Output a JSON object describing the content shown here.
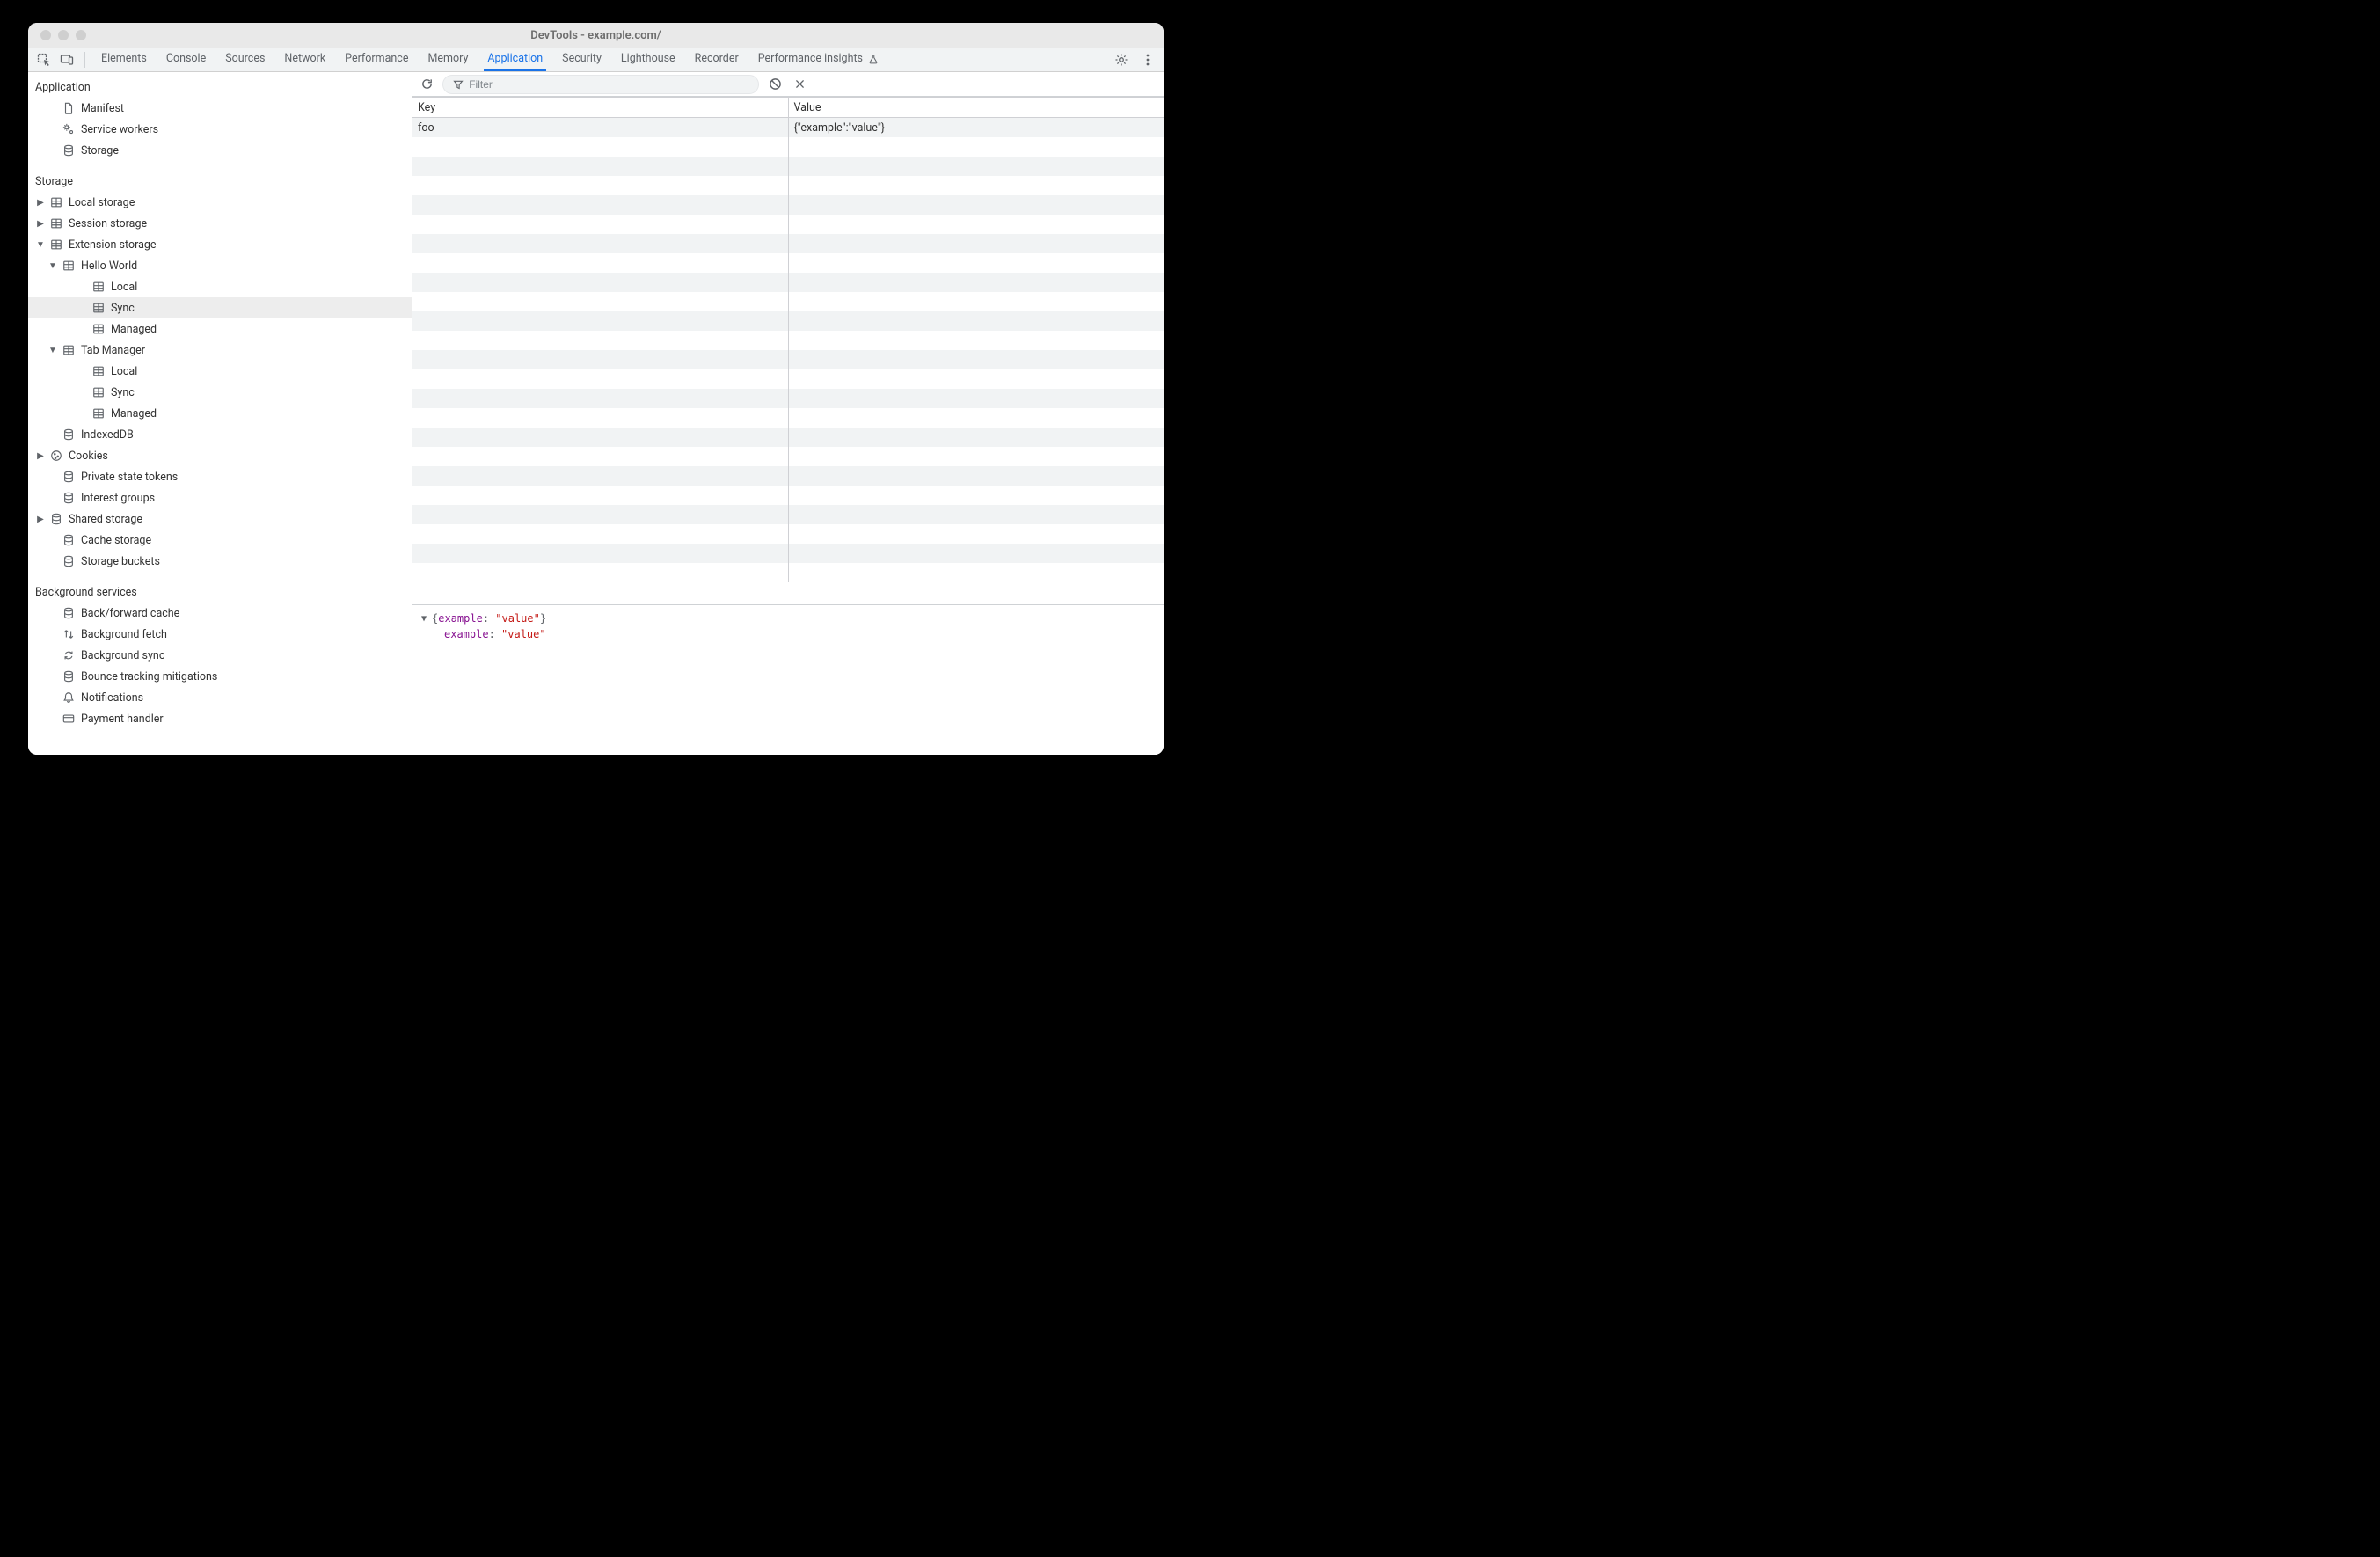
{
  "window_title": "DevTools - example.com/",
  "tabs": {
    "elements": "Elements",
    "console": "Console",
    "sources": "Sources",
    "network": "Network",
    "performance": "Performance",
    "memory": "Memory",
    "application": "Application",
    "security": "Security",
    "lighthouse": "Lighthouse",
    "recorder": "Recorder",
    "perf_insights": "Performance insights"
  },
  "filter": {
    "placeholder": "Filter"
  },
  "sidebar": {
    "sections": {
      "application": {
        "header": "Application",
        "manifest": "Manifest",
        "service_workers": "Service workers",
        "storage": "Storage"
      },
      "storage": {
        "header": "Storage",
        "local_storage": "Local storage",
        "session_storage": "Session storage",
        "extension_storage": "Extension storage",
        "hello_world": "Hello World",
        "hw_local": "Local",
        "hw_sync": "Sync",
        "hw_managed": "Managed",
        "tab_manager": "Tab Manager",
        "tm_local": "Local",
        "tm_sync": "Sync",
        "tm_managed": "Managed",
        "indexeddb": "IndexedDB",
        "cookies": "Cookies",
        "private_state_tokens": "Private state tokens",
        "interest_groups": "Interest groups",
        "shared_storage": "Shared storage",
        "cache_storage": "Cache storage",
        "storage_buckets": "Storage buckets"
      },
      "background": {
        "header": "Background services",
        "bf_cache": "Back/forward cache",
        "bg_fetch": "Background fetch",
        "bg_sync": "Background sync",
        "bounce": "Bounce tracking mitigations",
        "notifications": "Notifications",
        "payment": "Payment handler"
      }
    }
  },
  "table": {
    "cols": {
      "key": "Key",
      "value": "Value"
    },
    "rows": [
      {
        "key": "foo",
        "value": "{\"example\":\"value\"}"
      }
    ]
  },
  "detail": {
    "summary_pre": "{",
    "summary_prop": "example",
    "summary_sep": ": ",
    "summary_val": "\"value\"",
    "summary_post": "}",
    "line_prop": "example",
    "line_sep": ": ",
    "line_val": "\"value\""
  }
}
